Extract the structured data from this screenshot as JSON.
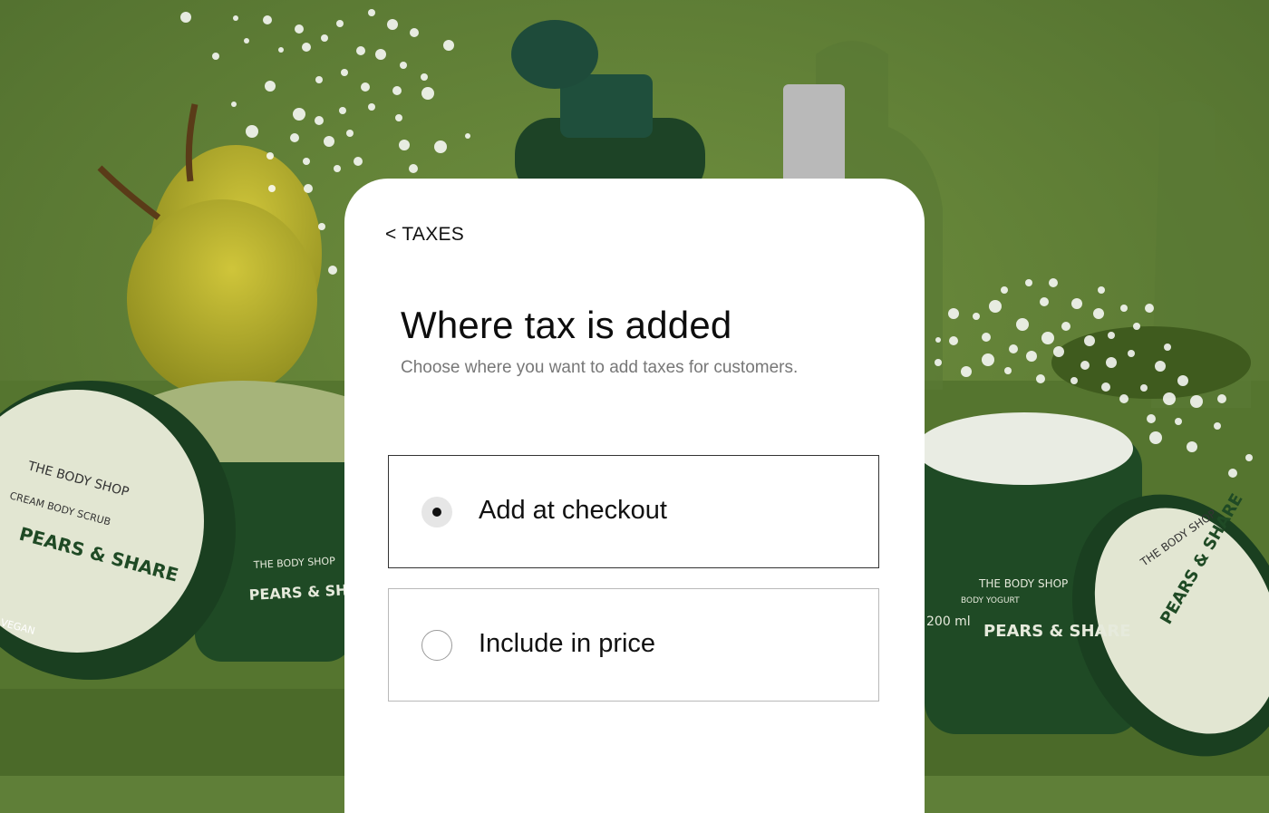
{
  "header": {
    "back_label": "< TAXES"
  },
  "content": {
    "title": "Where tax is added",
    "subtitle": "Choose where you want to add taxes for customers."
  },
  "options": [
    {
      "label": "Add at checkout",
      "selected": true
    },
    {
      "label": "Include in price",
      "selected": false
    }
  ],
  "background": {
    "brand_text": "THE BODY SHOP",
    "product_name": "PEARS & SHARE",
    "scrub_subtitle": "CREAM BODY SCRUB",
    "yogurt_subtitle": "BODY YOGURT",
    "volume_label": "200 ml",
    "vegan_label": "VEGAN"
  },
  "colors": {
    "background_green": "#5f7f38",
    "jar_green": "#1f4a25",
    "pear_yellow": "#b8b12a",
    "panel_white": "#ffffff"
  }
}
